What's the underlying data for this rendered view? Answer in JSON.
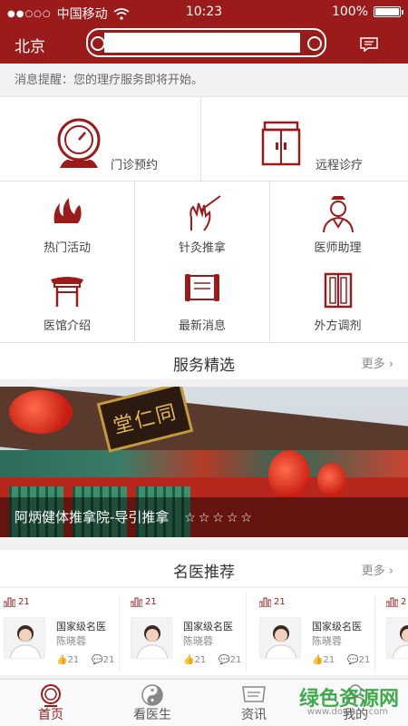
{
  "status_bar": {
    "signal": "●●○○○",
    "carrier": "中国移动",
    "time": "10:23",
    "battery": "100%"
  },
  "header": {
    "city": "北京",
    "search_placeholder": "",
    "search_value": ""
  },
  "notice": "消息提醒：您的理疗服务即将开始。",
  "services_top": [
    {
      "label": "门诊预约",
      "icon": "clock-icon"
    },
    {
      "label": "远程诊疗",
      "icon": "cabinet-icon"
    }
  ],
  "services_grid": [
    {
      "label": "热门活动",
      "icon": "flame-icon"
    },
    {
      "label": "针灸推拿",
      "icon": "acupuncture-icon"
    },
    {
      "label": "医师助理",
      "icon": "doctor-assistant-icon"
    },
    {
      "label": "医馆介绍",
      "icon": "pavilion-icon"
    },
    {
      "label": "最新消息",
      "icon": "scroll-icon"
    },
    {
      "label": "外方调剂",
      "icon": "medicine-cabinet-icon"
    }
  ],
  "featured": {
    "title": "服务精选",
    "more": "更多",
    "banner_caption": "阿炳健体推拿院-导引推拿",
    "banner_stars": "☆☆☆☆☆",
    "plaque_text": "堂仁同"
  },
  "doctors": {
    "title": "名医推荐",
    "more": "更多",
    "cards": [
      {
        "likes": "21",
        "level": "国家级名医",
        "name": "陈晓蓉",
        "thumbs": "21",
        "comments": "21"
      },
      {
        "likes": "21",
        "level": "国家级名医",
        "name": "陈晓蓉",
        "thumbs": "21",
        "comments": "21"
      },
      {
        "likes": "21",
        "level": "国家级名医",
        "name": "陈晓蓉",
        "thumbs": "21",
        "comments": "21"
      },
      {
        "likes": "2",
        "level": "",
        "name": "",
        "thumbs": "",
        "comments": ""
      }
    ]
  },
  "tabs": [
    {
      "label": "首页",
      "active": true
    },
    {
      "label": "看医生",
      "active": false
    },
    {
      "label": "资讯",
      "active": false
    },
    {
      "label": "我的",
      "active": false
    }
  ],
  "watermark": {
    "text": "绿色资源网",
    "sub": "www.downcc.com"
  },
  "colors": {
    "brand": "#9b1b1b",
    "background": "#f2f2f2"
  }
}
